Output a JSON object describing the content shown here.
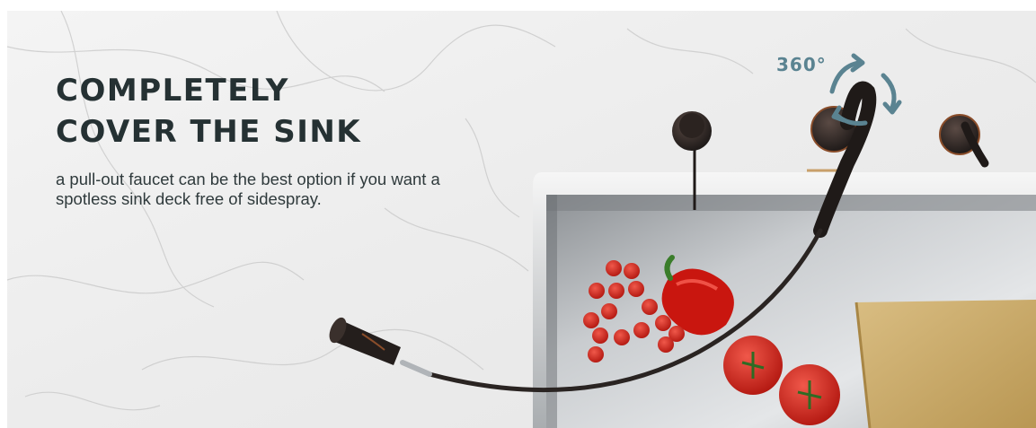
{
  "banner": {
    "headline": {
      "line1": "COMPLETELY",
      "line2": "COVER THE SINK"
    },
    "subtext": {
      "line1": "a pull-out faucet can be the best option if you want a",
      "line2": "spotless sink deck free of sidespray."
    },
    "rotation_label": "360°",
    "colors": {
      "headline": "#253133",
      "body_text": "#2f3a3c",
      "rotation_accent": "#5a8391",
      "faucet": "#2a2422",
      "sink_steel": "#cfd2d4",
      "tomato": "#d8261c",
      "cutting_board": "#d8b977"
    },
    "icons": [
      "rotation-arrow-icon"
    ]
  }
}
